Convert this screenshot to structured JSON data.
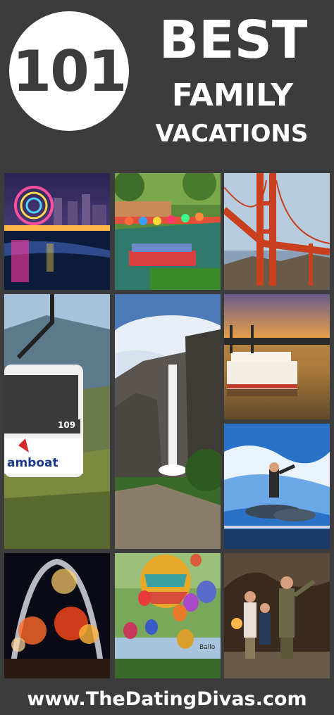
{
  "header": {
    "badge_number": "101",
    "title_line1": "BEST",
    "title_line2": "FAMILY",
    "title_line3": "VACATIONS"
  },
  "photos": {
    "gondola_sign": "amboat",
    "gondola_number": "109",
    "balloon_caption": "Ballo"
  },
  "footer": {
    "url": "www.TheDatingDivas.com"
  },
  "colors": {
    "background": "#3c3c3c",
    "text": "#ffffff"
  }
}
